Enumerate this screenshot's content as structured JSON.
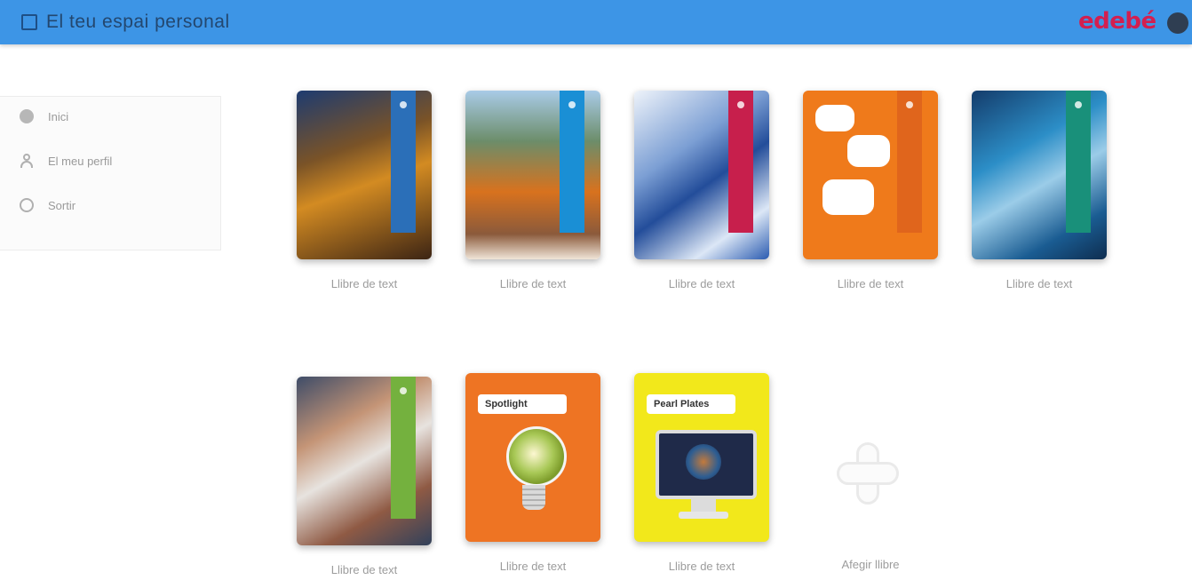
{
  "header": {
    "title": "El teu espai personal",
    "brand": "edebé",
    "accent_color": "#3d95e6",
    "brand_color": "#d31f50"
  },
  "sidebar": {
    "items": [
      {
        "label": "Inici",
        "icon": "home-icon"
      },
      {
        "label": "El meu perfil",
        "icon": "user-icon"
      },
      {
        "label": "Sortir",
        "icon": "exit-icon"
      }
    ]
  },
  "books": [
    {
      "title": "Llibre de text"
    },
    {
      "title": "Llibre de text"
    },
    {
      "title": "Llibre de text"
    },
    {
      "title": "Llibre de text"
    },
    {
      "title": "Llibre de text"
    },
    {
      "title": "Llibre de text"
    },
    {
      "title": "Llibre de text",
      "cover_label": "Spotlight"
    },
    {
      "title": "Llibre de text",
      "cover_label": "Pearl Plates"
    }
  ],
  "add_tile": {
    "label": "Afegir llibre"
  }
}
